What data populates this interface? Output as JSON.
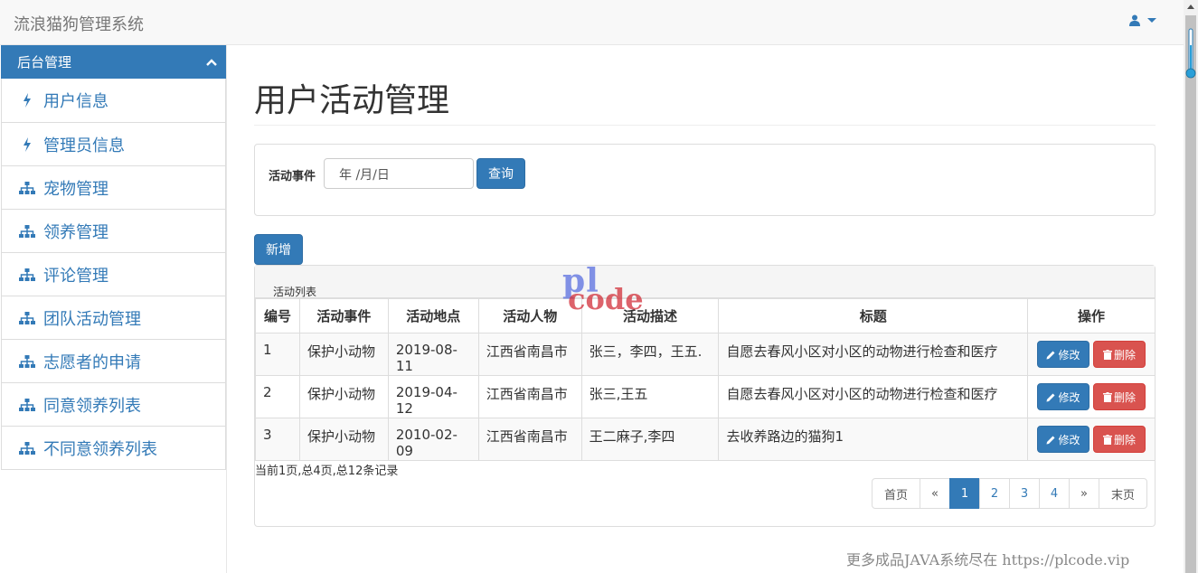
{
  "navbar": {
    "brand": "流浪猫狗管理系统"
  },
  "sidebar": {
    "header": "后台管理",
    "items": [
      {
        "label": "用户信息",
        "icon": "bolt-icon"
      },
      {
        "label": "管理员信息",
        "icon": "bolt-icon"
      },
      {
        "label": "宠物管理",
        "icon": "sitemap-icon"
      },
      {
        "label": "领养管理",
        "icon": "sitemap-icon"
      },
      {
        "label": "评论管理",
        "icon": "sitemap-icon"
      },
      {
        "label": "团队活动管理",
        "icon": "sitemap-icon"
      },
      {
        "label": "志愿者的申请",
        "icon": "sitemap-icon"
      },
      {
        "label": "同意领养列表",
        "icon": "sitemap-icon"
      },
      {
        "label": "不同意领养列表",
        "icon": "sitemap-icon"
      }
    ]
  },
  "main": {
    "title": "用户活动管理",
    "search": {
      "label": "活动事件",
      "date_value": "年 /月/日",
      "query_label": "查询"
    },
    "add_label": "新增",
    "table": {
      "heading": "活动列表",
      "columns": [
        "编号",
        "活动事件",
        "活动地点",
        "活动人物",
        "活动描述",
        "标题",
        "操作"
      ],
      "rows": [
        {
          "id": "1",
          "event": "保护小动物",
          "place": "2019-08-11",
          "people": "江西省南昌市",
          "desc": "张三，李四，王五.",
          "title": "自愿去春风小区对小区的动物进行检查和医疗"
        },
        {
          "id": "2",
          "event": "保护小动物",
          "place": "2019-04-12",
          "people": "江西省南昌市",
          "desc": "张三,王五",
          "title": "自愿去春风小区对小区的动物进行检查和医疗"
        },
        {
          "id": "3",
          "event": "保护小动物",
          "place": "2010-02-09",
          "people": "江西省南昌市",
          "desc": "王二麻子,李四",
          "title": "去收养路边的猫狗1"
        }
      ],
      "edit_label": "修改",
      "delete_label": "删除"
    },
    "record_info": "当前1页,总4页,总12条记录",
    "pager": {
      "first": "首页",
      "prev": "«",
      "pages": [
        "1",
        "2",
        "3",
        "4"
      ],
      "next": "»",
      "last": "末页",
      "current": "1"
    }
  },
  "watermark": {
    "top": "pl",
    "bottom": "code"
  },
  "footer_watermark": "更多成品JAVA系统尽在 https://plcode.vip",
  "colors": {
    "primary": "#337ab7",
    "danger": "#d9534f",
    "navbar_bg": "#f8f8f8"
  }
}
